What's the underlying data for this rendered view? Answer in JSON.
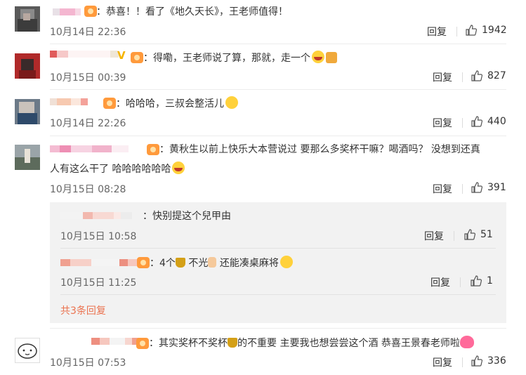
{
  "comments": [
    {
      "text": "：恭喜！！看了《地久天长》，王老师值得！",
      "time": "10月14日 22:36",
      "reply": "回复",
      "likes": "1942"
    },
    {
      "text": "：得嘞，王老师说了算，那就，走一个",
      "time": "10月15日 00:39",
      "reply": "回复",
      "likes": "827"
    },
    {
      "text": "：哈哈哈，三叔会整活儿",
      "time": "10月14日 22:26",
      "reply": "回复",
      "likes": "440"
    },
    {
      "text_line1": "：黄秋生以前上快乐大本营说过 要那么多奖杯干嘛？喝酒吗？ 没想到还真",
      "text_line2": "人有这么干了 哈哈哈哈哈哈",
      "time": "10月15日 08:28",
      "reply": "回复",
      "likes": "391"
    }
  ],
  "replies": [
    {
      "text": "：快别提这个兒甲由",
      "time": "10月15日 10:58",
      "reply": "回复",
      "likes": "51"
    },
    {
      "text_a": "：4个",
      "text_b": " 不光",
      "text_c": " 还能凑桌麻将",
      "time": "10月15日 11:25",
      "reply": "回复",
      "likes": "1"
    }
  ],
  "more_replies": "共3条回复",
  "last_comment": {
    "text_a": "：其实奖杯不奖杯",
    "text_b": "的不重要 主要我也想尝尝这个酒 恭喜王景春老师啦",
    "time": "10月15日 07:53",
    "reply": "回复",
    "likes": "336"
  },
  "colors": {
    "accent": "#eb7350",
    "sub_bg": "#f2f2f2",
    "badge": "#ff9a3c"
  }
}
